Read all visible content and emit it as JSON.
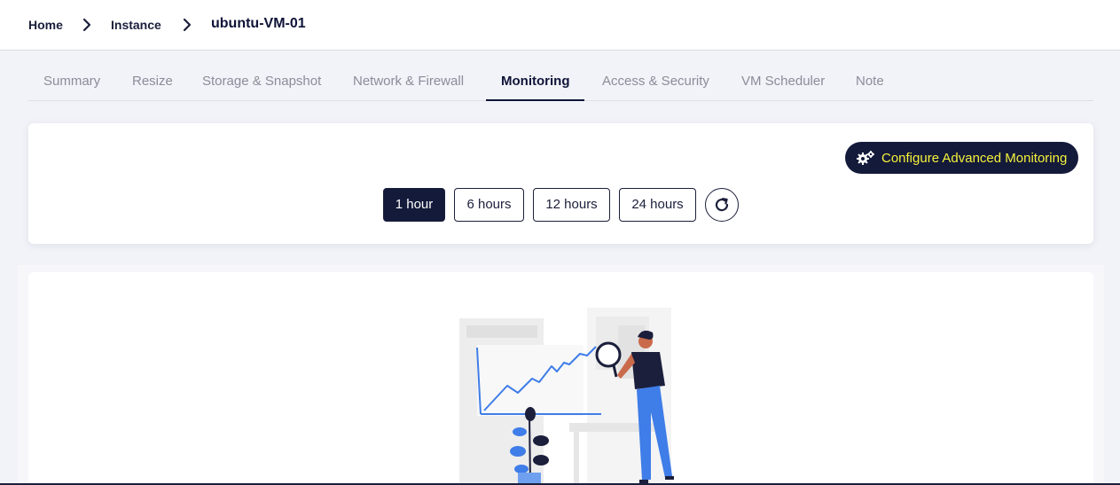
{
  "breadcrumb": {
    "home": "Home",
    "instance": "Instance",
    "current": "ubuntu-VM-01"
  },
  "tabs": [
    {
      "label": "Summary",
      "active": false
    },
    {
      "label": "Resize",
      "active": false
    },
    {
      "label": "Storage & Snapshot",
      "active": false
    },
    {
      "label": "Network & Firewall",
      "active": false
    },
    {
      "label": "Monitoring",
      "active": true
    },
    {
      "label": "Access & Security",
      "active": false
    },
    {
      "label": "VM Scheduler",
      "active": false
    },
    {
      "label": "Note",
      "active": false
    }
  ],
  "monitoring": {
    "advanced_label": "Configure Advanced Monitoring",
    "advanced_icon": "gears-icon",
    "ranges": [
      {
        "label": "1 hour",
        "selected": true
      },
      {
        "label": "6 hours",
        "selected": false
      },
      {
        "label": "12 hours",
        "selected": false
      },
      {
        "label": "24 hours",
        "selected": false
      }
    ],
    "refresh_icon": "refresh-icon"
  },
  "colors": {
    "primary": "#141a3a",
    "accent_text": "#f5f23a",
    "illustration_blue": "#3f7de8"
  }
}
